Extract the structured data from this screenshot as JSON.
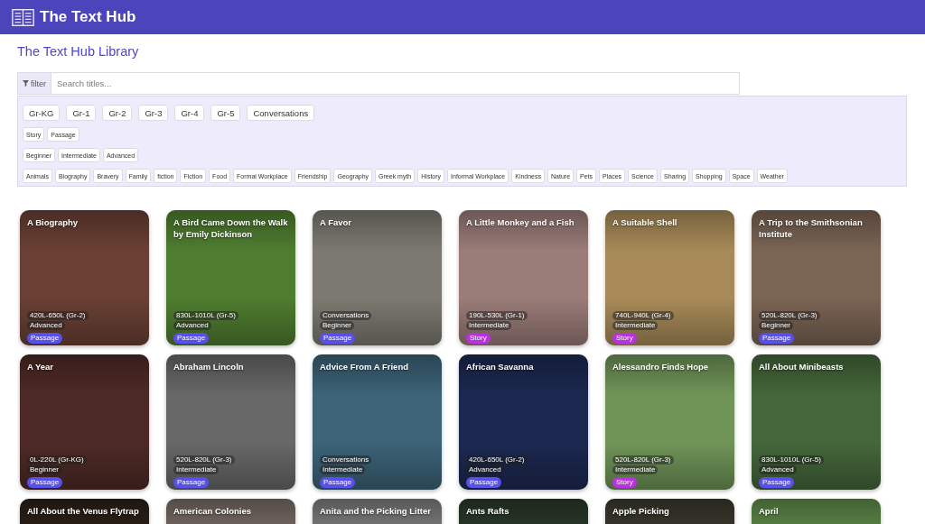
{
  "header": {
    "brand": "The Text Hub"
  },
  "page": {
    "title": "The Text Hub Library"
  },
  "search": {
    "filter_label": "filter",
    "placeholder": "Search titles..."
  },
  "filters": {
    "grades": [
      {
        "label": "Gr-KG",
        "selected": false
      },
      {
        "label": "Gr-1",
        "selected": false
      },
      {
        "label": "Gr-2",
        "selected": false
      },
      {
        "label": "Gr-3",
        "selected": false
      },
      {
        "label": "Gr-4",
        "selected": false
      },
      {
        "label": "Gr-5",
        "selected": false
      },
      {
        "label": "Conversations",
        "selected": false
      }
    ],
    "types": [
      {
        "label": "Story",
        "selected": false
      },
      {
        "label": "Passage",
        "selected": false
      }
    ],
    "levels": [
      {
        "label": "Beginner",
        "selected": false
      },
      {
        "label": "Intermediate",
        "selected": false
      },
      {
        "label": "Advanced",
        "selected": false
      }
    ],
    "topics": [
      {
        "label": "Animals",
        "selected": false
      },
      {
        "label": "Biography",
        "selected": false
      },
      {
        "label": "Bravery",
        "selected": false
      },
      {
        "label": "Family",
        "selected": false
      },
      {
        "label": "fiction",
        "selected": false
      },
      {
        "label": "Fiction",
        "selected": false
      },
      {
        "label": "Food",
        "selected": false
      },
      {
        "label": "Formal Workplace",
        "selected": false
      },
      {
        "label": "Friendship",
        "selected": false
      },
      {
        "label": "Geography",
        "selected": false
      },
      {
        "label": "Greek myth",
        "selected": false
      },
      {
        "label": "History",
        "selected": false
      },
      {
        "label": "Informal Workplace",
        "selected": false
      },
      {
        "label": "Kindness",
        "selected": false
      },
      {
        "label": "Nature",
        "selected": false
      },
      {
        "label": "Pets",
        "selected": false
      },
      {
        "label": "Places",
        "selected": false
      },
      {
        "label": "Science",
        "selected": false
      },
      {
        "label": "Sharing",
        "selected": false
      },
      {
        "label": "Shopping",
        "selected": false
      },
      {
        "label": "Space",
        "selected": false
      },
      {
        "label": "Weather",
        "selected": false
      }
    ]
  },
  "cards": [
    {
      "title": "A Biography",
      "lexile": "420L-650L (Gr-2)",
      "level": "Advanced",
      "tag": {
        "label": "Passage",
        "color": "#5850ec"
      }
    },
    {
      "title": "A Bird Came Down the Walk by Emily Dickinson",
      "lexile": "830L-1010L (Gr-5)",
      "level": "Advanced",
      "tag": {
        "label": "Passage",
        "color": "#5850ec"
      }
    },
    {
      "title": "A Favor",
      "lexile": "Conversations",
      "level": "Beginner",
      "tag": {
        "label": "Passage",
        "color": "#5850ec"
      }
    },
    {
      "title": "A Little Monkey and a Fish",
      "lexile": "190L-530L (Gr-1)",
      "level": "Intermediate",
      "tag": {
        "label": "Story",
        "color": "#b832e0"
      }
    },
    {
      "title": "A Suitable Shell",
      "lexile": "740L-940L (Gr-4)",
      "level": "Intermediate",
      "tag": {
        "label": "Story",
        "color": "#b832e0"
      }
    },
    {
      "title": "A Trip to the Smithsonian Institute",
      "lexile": "520L-820L (Gr-3)",
      "level": "Beginner",
      "tag": {
        "label": "Passage",
        "color": "#5850ec"
      }
    },
    {
      "title": "A Year",
      "lexile": "0L-220L (Gr-KG)",
      "level": "Beginner",
      "tag": {
        "label": "Passage",
        "color": "#5850ec"
      }
    },
    {
      "title": "Abraham Lincoln",
      "lexile": "520L-820L (Gr-3)",
      "level": "Intermediate",
      "tag": {
        "label": "Passage",
        "color": "#5850ec"
      }
    },
    {
      "title": "Advice From A Friend",
      "lexile": "Conversations",
      "level": "Intermediate",
      "tag": {
        "label": "Passage",
        "color": "#5850ec"
      }
    },
    {
      "title": "African Savanna",
      "lexile": "420L-650L (Gr-2)",
      "level": "Advanced",
      "tag": {
        "label": "Passage",
        "color": "#5850ec"
      }
    },
    {
      "title": "Alessandro Finds Hope",
      "lexile": "520L-820L (Gr-3)",
      "level": "Intermediate",
      "tag": {
        "label": "Story",
        "color": "#b832e0"
      }
    },
    {
      "title": "All About Minibeasts",
      "lexile": "830L-1010L (Gr-5)",
      "level": "Advanced",
      "tag": {
        "label": "Passage",
        "color": "#5850ec"
      }
    },
    {
      "title": "All About the Venus Flytrap"
    },
    {
      "title": "American Colonies"
    },
    {
      "title": "Anita and the Picking Litter"
    },
    {
      "title": "Ants Rafts"
    },
    {
      "title": "Apple Picking"
    },
    {
      "title": "April"
    }
  ]
}
